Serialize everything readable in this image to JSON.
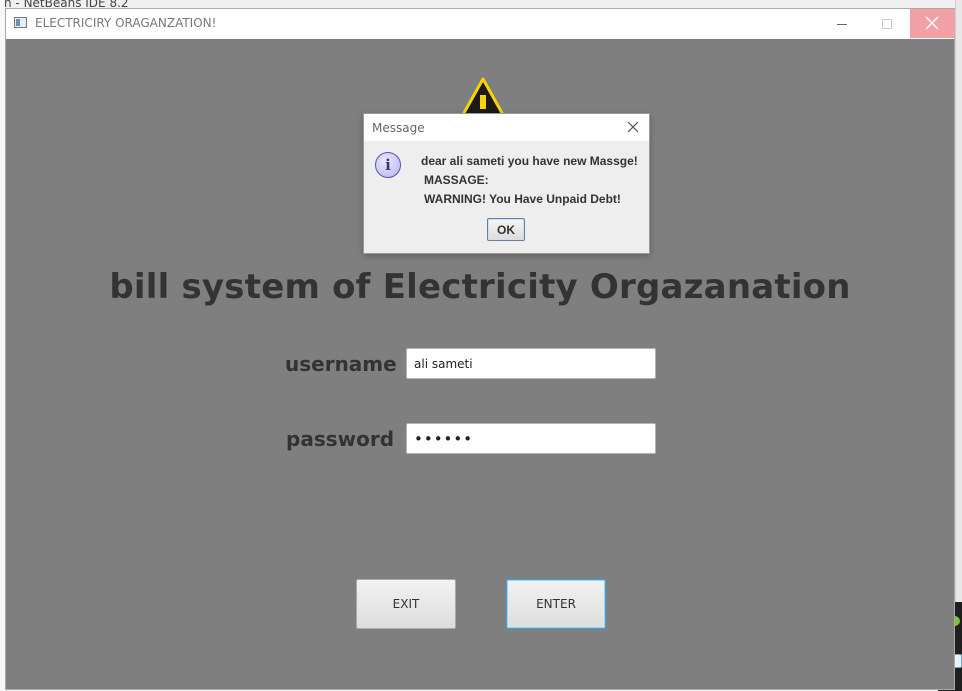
{
  "background": {
    "ide_title": "n - NetBeans IDE 8.2"
  },
  "window": {
    "title": "ELECTRICIRY ORAGANZATION!",
    "close_color": "#f1a1a6",
    "background_color": "#7f7f7f"
  },
  "main": {
    "heading": "bill system of Electricity Orgazanation",
    "username_label": "username",
    "username_value": "ali sameti",
    "password_label": "password",
    "password_value": "••••••",
    "exit_label": "EXIT",
    "enter_label": "ENTER",
    "logo_icon": "warning-triangle-icon"
  },
  "dialog": {
    "title": "Message",
    "line1": "dear ali sameti you have new Massge!",
    "line2": "MASSAGE:",
    "line3": "WARNING! You Have Unpaid Debt!",
    "ok_label": "OK",
    "icon": "info-icon"
  }
}
